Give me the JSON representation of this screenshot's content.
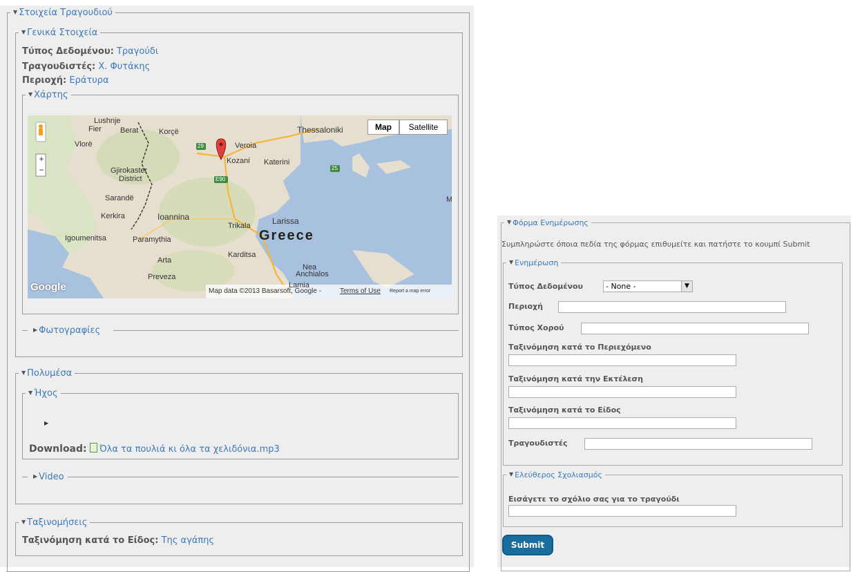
{
  "left": {
    "song_details": {
      "legend": "Στοιχεία Τραγουδιού"
    },
    "general": {
      "legend": "Γενικά Στοιχεία",
      "data_type_label": "Τύπος Δεδομένου:",
      "data_type_value": "Τραγούδι",
      "singers_label": "Τραγουδιστές:",
      "singers_value": "Χ. Φυτάκης",
      "region_label": "Περιοχή:",
      "region_value": "Εράτυρα"
    },
    "map": {
      "legend": "Χάρτης",
      "map_button": "Map",
      "satellite_button": "Satellite",
      "zoom_in": "+",
      "zoom_out": "−",
      "country_label": "Greece",
      "google_logo": "Google",
      "attribution": "Map data ©2013 Basarsoft, Google -",
      "terms": "Terms of Use",
      "report": "Report a map error",
      "places": {
        "thessaloniki": "Thessaloniki",
        "fier": "Fier",
        "berat": "Berat",
        "korce": "Korçë",
        "vlore": "Vlorë",
        "veroia": "Veroia",
        "kozani": "Kozani",
        "katerini": "Katerini",
        "gjirokaster": "Gjirokaster",
        "gjirokaster_district": "District",
        "sarande": "Sarandë",
        "kerkira": "Kerkira",
        "ioannina": "Ioannina",
        "igoumenitsa": "Igoumenitsa",
        "paramythia": "Paramythia",
        "trikala": "Trikala",
        "larissa": "Larissa",
        "karditsa": "Karditsa",
        "arta": "Arta",
        "preveza": "Preveza",
        "lamia": "Lamia",
        "nea": "Nea",
        "anchialos": "Anchialos",
        "lushnje": "Lushnje",
        "road_29": "29",
        "road_e90": "E90",
        "road_25": "25",
        "m_edge": "M"
      }
    },
    "photos": {
      "legend": "Φωτογραφίες"
    },
    "multimedia": {
      "legend": "Πολυμέσα"
    },
    "audio": {
      "legend": "Ήχος",
      "download_label": "Download:",
      "file_name": "Όλα τα πουλιά κι όλα τα χελιδόνια.mp3"
    },
    "video": {
      "legend": "Video"
    },
    "classifications": {
      "legend": "Ταξινομήσεις",
      "genre_label": "Ταξινόμηση κατά το Είδος:",
      "genre_value": "Της αγάπης"
    }
  },
  "right": {
    "form_legend": "Φόρμα Ενημέρωσης",
    "instructions": "Συμπληρώστε όποια πεδία της φόρμας επιθυμείτε και πατήστε το κουμπί Submit",
    "update_legend": "Ενημέρωση",
    "data_type_label": "Τύπος Δεδομένου",
    "data_type_selected": "- None -",
    "region_label": "Περιοχή",
    "dance_type_label": "Τύπος Χορού",
    "content_class_label": "Ταξινόμηση κατά το Περιεχόμενο",
    "performance_class_label": "Ταξινόμηση κατά την Εκτέλεση",
    "genre_class_label": "Ταξινόμηση κατά το Είδος",
    "singers_label": "Τραγουδιστές",
    "comment_legend": "Ελεύθερος Σχολιασμός",
    "comment_label": "Εισάγετε το σχόλιο σας για το τραγούδι",
    "submit_label": "Submit"
  },
  "colors": {
    "link": "#3b79b8",
    "panel_bg": "#eeeeee",
    "submit_bg": "#1a6e9e"
  }
}
